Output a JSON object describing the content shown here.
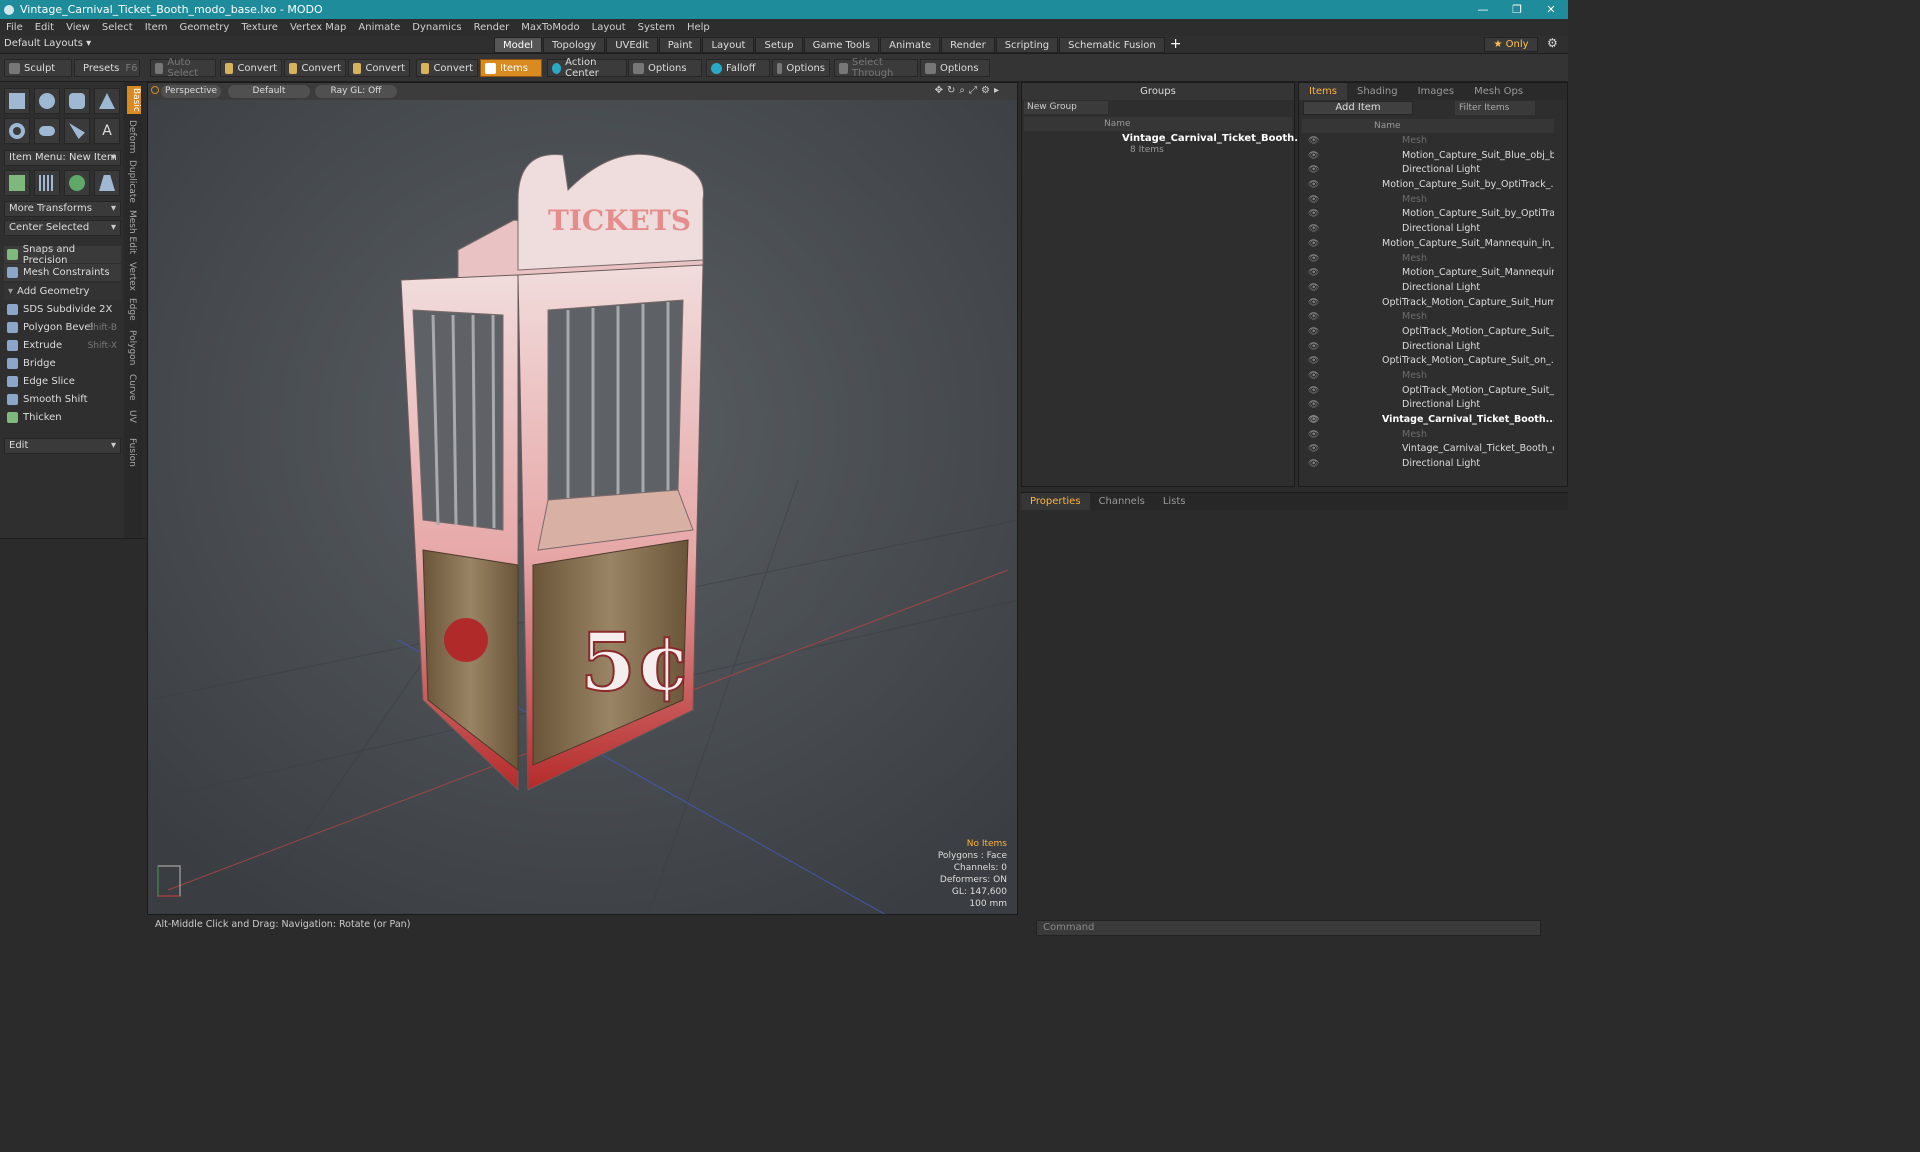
{
  "window": {
    "title": "Vintage_Carnival_Ticket_Booth_modo_base.lxo - MODO",
    "min": "—",
    "max": "❐",
    "close": "✕"
  },
  "menu": [
    "File",
    "Edit",
    "View",
    "Select",
    "Item",
    "Geometry",
    "Texture",
    "Vertex Map",
    "Animate",
    "Dynamics",
    "Render",
    "MaxToModo",
    "Layout",
    "System",
    "Help"
  ],
  "layout_selector": "Default Layouts ▾",
  "layout_tabs": [
    "Model",
    "Topology",
    "UVEdit",
    "Paint",
    "Layout",
    "Setup",
    "Game Tools",
    "Animate",
    "Render",
    "Scripting",
    "Schematic Fusion"
  ],
  "only_label": "★  Only",
  "toolbar": {
    "sculpt": "Sculpt",
    "presets": "Presets",
    "presets_key": "F6",
    "auto_select": "Auto Select",
    "convert1": "Convert",
    "convert2": "Convert",
    "convert3": "Convert",
    "convert4": "Convert",
    "items": "Items",
    "action_center": "Action Center",
    "options1": "Options",
    "falloff": "Falloff",
    "options2": "Options",
    "select_through": "Select Through",
    "options3": "Options"
  },
  "left_panel": {
    "item_menu": "Item Menu: New Item",
    "more_transforms": "More Transforms",
    "center_selected": "Center Selected",
    "snaps": "Snaps and Precision",
    "mesh_constraints": "Mesh Constraints",
    "add_geometry": "Add Geometry",
    "tools": [
      {
        "label": "SDS Subdivide 2X",
        "key": ""
      },
      {
        "label": "Polygon Bevel",
        "key": "Shift-B"
      },
      {
        "label": "Extrude",
        "key": "Shift-X"
      },
      {
        "label": "Bridge",
        "key": ""
      },
      {
        "label": "Edge Slice",
        "key": ""
      },
      {
        "label": "Smooth Shift",
        "key": ""
      },
      {
        "label": "Thicken",
        "key": ""
      }
    ],
    "edit": "Edit",
    "vtabs": [
      "Basic",
      "Deform",
      "Duplicate",
      "Mesh Edit",
      "Vertex",
      "Edge",
      "Polygon",
      "Curve",
      "UV",
      "Fusion"
    ]
  },
  "viewport": {
    "perspective": "Perspective",
    "default": "Default",
    "raygl": "Ray GL: Off",
    "info": {
      "no_items": "No Items",
      "polygons": "Polygons : Face",
      "channels": "Channels: 0",
      "deformers": "Deformers: ON",
      "gl": "GL: 147,600",
      "scale": "100 mm"
    },
    "sign_text": "5¢",
    "header_text": "TICKETS"
  },
  "status": "Alt-Middle Click and Drag:   Navigation: Rotate (or Pan)",
  "groups": {
    "title": "Groups",
    "new_group": "New Group",
    "col_name": "Name",
    "entry_name": "Vintage_Carnival_Ticket_Booth...",
    "entry_count": "8 Items"
  },
  "items_panel": {
    "tabs": [
      "Items",
      "Shading",
      "Images",
      "Mesh Ops"
    ],
    "add_item": "Add Item",
    "filter": "Filter Items",
    "col_name": "Name",
    "rows": [
      {
        "label": "Mesh",
        "indent": 2,
        "kind": "dim"
      },
      {
        "label": "Motion_Capture_Suit_Blue_obj_base",
        "indent": 2,
        "kind": "norm"
      },
      {
        "label": "Directional Light",
        "indent": 2,
        "kind": "norm"
      },
      {
        "label": "Motion_Capture_Suit_by_OptiTrack_...",
        "indent": 1,
        "kind": "norm"
      },
      {
        "label": "Mesh",
        "indent": 2,
        "kind": "dim"
      },
      {
        "label": "Motion_Capture_Suit_by_OptiTrac...",
        "indent": 2,
        "kind": "norm"
      },
      {
        "label": "Directional Light",
        "indent": 2,
        "kind": "norm"
      },
      {
        "label": "Motion_Capture_Suit_Mannequin_in_...",
        "indent": 1,
        "kind": "norm"
      },
      {
        "label": "Mesh",
        "indent": 2,
        "kind": "dim"
      },
      {
        "label": "Motion_Capture_Suit_Mannequin_i...",
        "indent": 2,
        "kind": "norm"
      },
      {
        "label": "Directional Light",
        "indent": 2,
        "kind": "norm"
      },
      {
        "label": "OptiTrack_Motion_Capture_Suit_Hum...",
        "indent": 1,
        "kind": "norm"
      },
      {
        "label": "Mesh",
        "indent": 2,
        "kind": "dim"
      },
      {
        "label": "OptiTrack_Motion_Capture_Suit_H...",
        "indent": 2,
        "kind": "norm"
      },
      {
        "label": "Directional Light",
        "indent": 2,
        "kind": "norm"
      },
      {
        "label": "OptiTrack_Motion_Capture_Suit_on_...",
        "indent": 1,
        "kind": "norm"
      },
      {
        "label": "Mesh",
        "indent": 2,
        "kind": "dim"
      },
      {
        "label": "OptiTrack_Motion_Capture_Suit_o...",
        "indent": 2,
        "kind": "norm"
      },
      {
        "label": "Directional Light",
        "indent": 2,
        "kind": "norm"
      },
      {
        "label": "Vintage_Carnival_Ticket_Booth...",
        "indent": 1,
        "kind": "bold"
      },
      {
        "label": "Mesh",
        "indent": 2,
        "kind": "dim"
      },
      {
        "label": "Vintage_Carnival_Ticket_Booth_ob...",
        "indent": 2,
        "kind": "norm"
      },
      {
        "label": "Directional Light",
        "indent": 2,
        "kind": "norm"
      }
    ]
  },
  "properties": {
    "tabs": [
      "Properties",
      "Channels",
      "Lists"
    ]
  },
  "command_placeholder": "Command"
}
